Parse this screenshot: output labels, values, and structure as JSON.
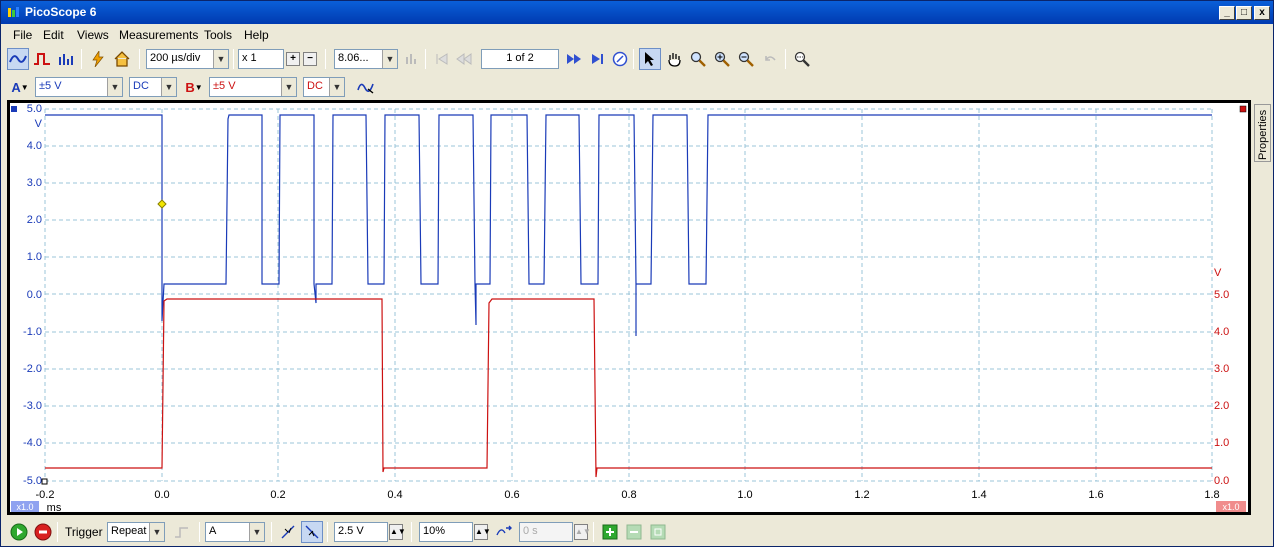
{
  "window": {
    "title": "PicoScope 6",
    "controls": [
      "_",
      "□",
      "x"
    ]
  },
  "menu": [
    "File",
    "Edit",
    "Views",
    "Measurements",
    "Tools",
    "Help"
  ],
  "toolbar": {
    "timebase": "200 µs/div",
    "zoom": "x 1",
    "samples": "8.06...",
    "buffer": "1 of 2"
  },
  "channels": {
    "a": {
      "label": "A",
      "range": "±5 V",
      "coupling": "DC",
      "color": "#1a3bb8"
    },
    "b": {
      "label": "B",
      "range": "±5 V",
      "coupling": "DC",
      "color": "#cc1111"
    }
  },
  "plot": {
    "left_axis": {
      "unit": "V",
      "ticks": [
        "5.0",
        "4.0",
        "3.0",
        "2.0",
        "1.0",
        "0.0",
        "-1.0",
        "-2.0",
        "-3.0",
        "-4.0",
        "-5.0"
      ],
      "scale": "x1.0"
    },
    "right_axis": {
      "unit": "V",
      "ticks": [
        "5.0",
        "4.0",
        "3.0",
        "2.0",
        "1.0",
        "0.0"
      ],
      "scale": "x1.0"
    },
    "x_axis": {
      "unit": "ms",
      "ticks": [
        "-0.2",
        "0.0",
        "0.2",
        "0.4",
        "0.6",
        "0.8",
        "1.0",
        "1.2",
        "1.4",
        "1.6",
        "1.8"
      ]
    }
  },
  "properties_tab": "Properties",
  "bottom": {
    "trigger_label": "Trigger",
    "trigger_mode": "Repeat",
    "trigger_source": "A",
    "threshold": "2.5 V",
    "pretrigger": "10%",
    "delay": "0 s"
  }
}
